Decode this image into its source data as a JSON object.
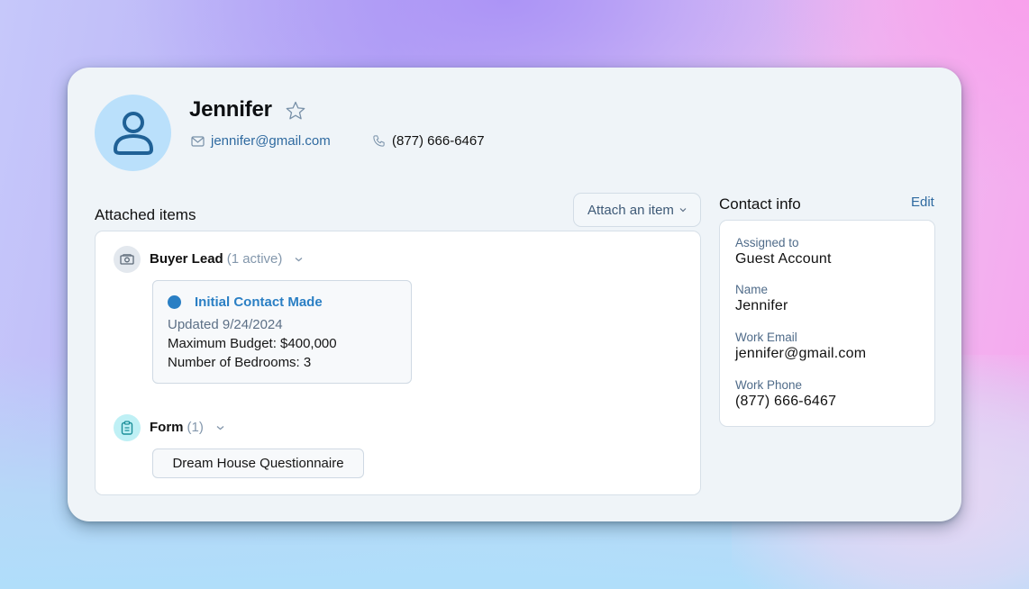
{
  "contact": {
    "name": "Jennifer",
    "email": "jennifer@gmail.com",
    "phone": "(877) 666-6467",
    "favorite": false
  },
  "icons": {
    "avatar": "user-icon",
    "favorite": "star-icon",
    "email": "mail-icon",
    "phone": "phone-icon",
    "buyer_lead": "money-icon",
    "form": "clipboard-icon",
    "chevron": "chevron-down-icon"
  },
  "attached": {
    "title": "Attached items",
    "attach_button": "Attach an item",
    "groups": [
      {
        "title": "Buyer Lead",
        "count": "(1 active)",
        "items": [
          {
            "status": "Initial Contact Made",
            "updated": "Updated 9/24/2024",
            "budget": "Maximum Budget: $400,000",
            "bedrooms": "Number of Bedrooms: 3"
          }
        ]
      },
      {
        "title": "Form",
        "count": "(1)",
        "items": [
          {
            "label": "Dream House Questionnaire"
          }
        ]
      }
    ]
  },
  "contact_info": {
    "title": "Contact info",
    "edit": "Edit",
    "fields": [
      {
        "label": "Assigned to",
        "value": "Guest Account"
      },
      {
        "label": "Name",
        "value": "Jennifer"
      },
      {
        "label": "Work Email",
        "value": "jennifer@gmail.com"
      },
      {
        "label": "Work Phone",
        "value": "(877) 666-6467"
      }
    ]
  },
  "colors": {
    "accent": "#2a7fc4",
    "link": "#2f6aa0",
    "avatar_bg": "#bae0fb",
    "card_bg": "#eff4f8"
  }
}
